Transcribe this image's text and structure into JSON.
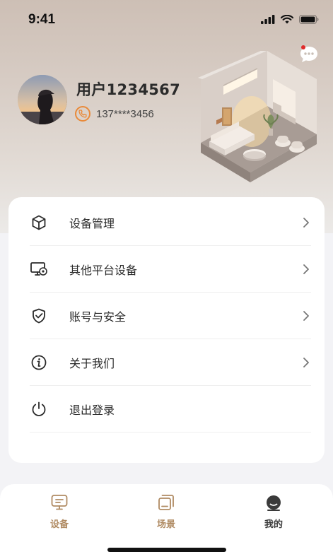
{
  "status_bar": {
    "time": "9:41",
    "icons": [
      "signal-icon",
      "wifi-icon",
      "battery-icon"
    ]
  },
  "header": {
    "message_icon": "chat-bubble-icon",
    "has_notification_dot": true,
    "accent_color": "#e98a3a",
    "notification_color": "#e02a2a"
  },
  "profile": {
    "username": "用户1234567",
    "phone": "137****3456"
  },
  "menu": {
    "items": [
      {
        "label": "设备管理",
        "icon": "cube-icon",
        "has_chevron": true
      },
      {
        "label": "其他平台设备",
        "icon": "monitor-gear-icon",
        "has_chevron": true
      },
      {
        "label": "账号与安全",
        "icon": "shield-check-icon",
        "has_chevron": true
      },
      {
        "label": "关于我们",
        "icon": "info-icon",
        "has_chevron": true
      },
      {
        "label": "退出登录",
        "icon": "power-icon",
        "has_chevron": false
      }
    ]
  },
  "tab_bar": {
    "tabs": [
      {
        "label": "设备",
        "icon": "device-icon",
        "active": false
      },
      {
        "label": "场景",
        "icon": "scene-icon",
        "active": false
      },
      {
        "label": "我的",
        "icon": "profile-icon",
        "active": true
      }
    ],
    "inactive_color": "#b08b63",
    "active_color": "#3a3a3a"
  }
}
